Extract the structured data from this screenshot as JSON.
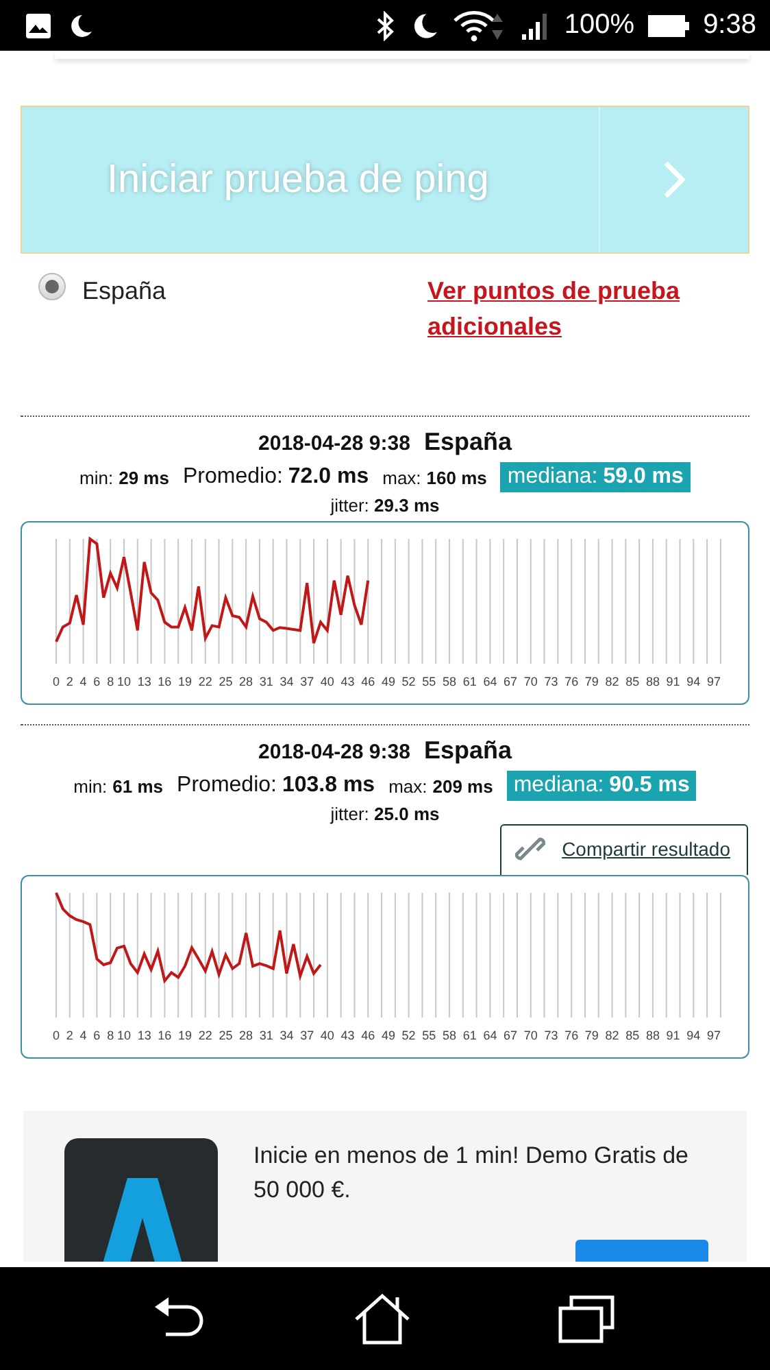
{
  "status_bar": {
    "battery": "100%",
    "time": "9:38"
  },
  "ping_button": {
    "label": "Iniciar prueba de ping"
  },
  "server": {
    "label": "España",
    "selected": true
  },
  "more_servers_link": "Ver puntos de prueba adicionales",
  "results": [
    {
      "date": "2018-04-28 9:38",
      "location": "España",
      "stats": [
        {
          "kind": "small",
          "label": "min:",
          "value": "29 ms"
        },
        {
          "kind": "large",
          "label": "Promedio:",
          "value": "72.0 ms"
        },
        {
          "kind": "small",
          "label": "max:",
          "value": "160 ms"
        },
        {
          "kind": "highlight",
          "label": "mediana:",
          "value": "59.0 ms"
        }
      ],
      "jitter": {
        "label": "jitter:",
        "value": "29.3 ms"
      },
      "x_labels": [
        "0",
        "2",
        "4",
        "6",
        "8",
        "10",
        "13",
        "16",
        "19",
        "22",
        "25",
        "28",
        "31",
        "34",
        "37",
        "40",
        "43",
        "46",
        "49",
        "52",
        "55",
        "58",
        "61",
        "64",
        "67",
        "70",
        "73",
        "76",
        "79",
        "82",
        "85",
        "88",
        "91",
        "94",
        "97"
      ]
    },
    {
      "date": "2018-04-28 9:38",
      "location": "España",
      "stats": [
        {
          "kind": "small",
          "label": "min:",
          "value": "61 ms"
        },
        {
          "kind": "large",
          "label": "Promedio:",
          "value": "103.8 ms"
        },
        {
          "kind": "small",
          "label": "max:",
          "value": "209 ms"
        },
        {
          "kind": "highlight",
          "label": "mediana:",
          "value": "90.5 ms"
        }
      ],
      "jitter": {
        "label": "jitter:",
        "value": "25.0 ms"
      },
      "share_button": "Compartir resultado",
      "x_labels": [
        "0",
        "2",
        "4",
        "6",
        "8",
        "10",
        "13",
        "16",
        "19",
        "22",
        "25",
        "28",
        "31",
        "34",
        "37",
        "40",
        "43",
        "46",
        "49",
        "52",
        "55",
        "58",
        "61",
        "64",
        "67",
        "70",
        "73",
        "76",
        "79",
        "82",
        "85",
        "88",
        "91",
        "94",
        "97"
      ]
    }
  ],
  "ad": {
    "text": "Inicie en menos de 1 min! Demo Gratis de 50 000 €."
  }
}
